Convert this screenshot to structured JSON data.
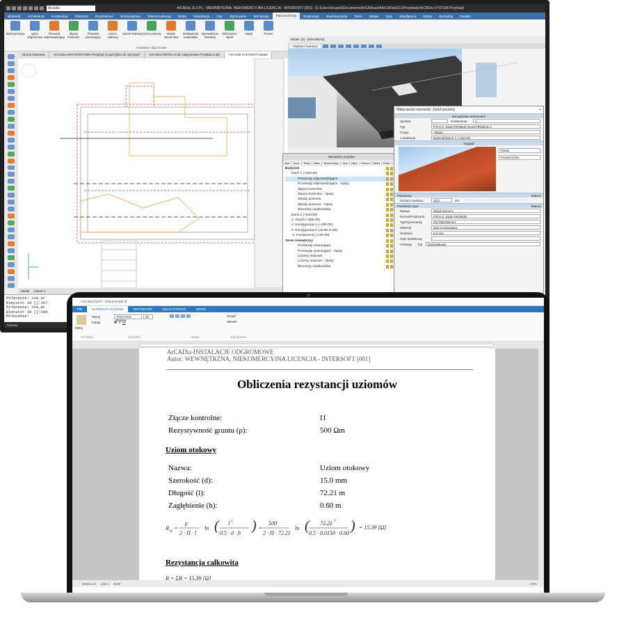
{
  "monitor": {
    "title": "ArCADia 15.0 PL - WEWNĘTRZNA, NIEKOMERCYJNA LICENCJA - INTERSOFT [001] - [C:\\Users\\knusek\\Documents\\ArCADiasoft\\ArCADia\\15.0\\Przyklady\\ArCADia SYSTEM Przyklad]",
    "layer_combo": "Arcadia",
    "menu": [
      "Biblioteki",
      "Architektura",
      "Konstrukcje",
      "Elektryka",
      "Rozdzielnice",
      "Niskoprądowe",
      "Telekomunikacja",
      "Woda",
      "Kanalizacja",
      "Gaz",
      "Ogrzewanie",
      "Wentylacja",
      "Piorunochrony",
      "Ewakuacja",
      "Inwentaryzacja",
      "Teren",
      "Wstaw",
      "Opis",
      "Współpraca",
      "Widok",
      "Zarządzaj",
      "Dodatki"
    ],
    "menu_active": "Piorunochrony",
    "ribbon": [
      {
        "label": "Zwód poziomy"
      },
      {
        "label": "Iglica odgromowa"
      },
      {
        "label": "Przewód odprowadzający"
      },
      {
        "label": "Złącze kontrolne"
      },
      {
        "label": "Przewód uziemiający"
      },
      {
        "label": "Uziom otokowy"
      },
      {
        "label": "Uziom kratowy"
      },
      {
        "label": "Uziom prętowy"
      },
      {
        "label": "Wykaz elementów"
      },
      {
        "label": "Zestawienie materiałów"
      },
      {
        "label": "Sprawdzenie instalacji"
      },
      {
        "label": "Obliczenia i raport"
      },
      {
        "label": "Opcje"
      },
      {
        "label": "Pomoc"
      }
    ],
    "ribbon_group": "Instalacje odgromowe",
    "doc_tabs": [
      "Strona Startowa",
      "ArCADia-ARCHITEKTURA Przyklad 11.apf (tylko do odczytu)*",
      "ArCADia-INSTALACJE Odgromowe Przyklad 1.apf",
      "ArCADia SYSTEM Przyklad"
    ],
    "model_tab": "Model",
    "layout_tab": "Arkusz 1",
    "command_lines": [
      "Polecenie: isa_ec",
      "Executor id []:107",
      "Polecenie: isa_ec",
      "Executor id []:108",
      "Polecenie:"
    ],
    "status": "Gotowy",
    "view3d_title": "Widok: [3] - [Niezależny]",
    "view3d_camera": "<Wybierz kamerę>",
    "project_manager": {
      "title": "Menadżer projektu",
      "tabs": [
        "Wid.",
        "Arch.",
        "Teren",
        "Bied.",
        "Woda Kana.",
        "Gaz",
        "Ogrz.",
        "Piorun",
        "Niska",
        "Elekt.",
        "Wentyl."
      ],
      "tree": [
        {
          "label": "Budynek",
          "indent": 0
        },
        {
          "label": "Dach 1 (+220.00)",
          "indent": 1
        },
        {
          "label": "Przewody odprowadzające",
          "indent": 2,
          "sel": true
        },
        {
          "label": "Przewody odprowadzające - Opisy",
          "indent": 2
        },
        {
          "label": "Złącza kontrolne",
          "indent": 2
        },
        {
          "label": "Złącza kontrolne - Opisy",
          "indent": 2
        },
        {
          "label": "Zwody poziome",
          "indent": 2
        },
        {
          "label": "Zwody poziome - Opisy",
          "indent": 2
        },
        {
          "label": "Elementy użytkownika",
          "indent": 2
        },
        {
          "label": "Dach 2 (+510.00)",
          "indent": 1
        },
        {
          "label": "2: Strych (+560.00)",
          "indent": 1
        },
        {
          "label": "1: Kondygnacja 1 (+280.00)",
          "indent": 1
        },
        {
          "label": "0: Kondygnacja 0 (±0.00=0.00)",
          "indent": 1
        },
        {
          "label": "-1: Fundamenty (-100.00)",
          "indent": 1
        },
        {
          "label": "Teren zewnętrzny",
          "indent": 0
        },
        {
          "label": "Przewody uziemiające",
          "indent": 2
        },
        {
          "label": "Przewody uziemiające - Opisy",
          "indent": 2
        },
        {
          "label": "Uziomy otokowe",
          "indent": 2
        },
        {
          "label": "Uziomy otokowe - Opisy",
          "indent": 2
        },
        {
          "label": "Elementy użytkownika",
          "indent": 2
        }
      ]
    },
    "properties": {
      "title": "Właściwości elementu: Zwód poziomy",
      "close": "×",
      "sec_manage": "Zarządzanie elementem",
      "symbol_label": "Symbol",
      "symbol_value": "",
      "id_label": "Id elementu",
      "id_value": "1",
      "typ_label": "Typ",
      "typ_value": "P.P.H.U. ELEKTROBUD ELEKTROBUD 1",
      "grupa_label": "Grupa",
      "grupa_value": "<Brak>",
      "lok_label": "Lokalizacja",
      "lok_value": "Budynek\\Dach 1 (+220.00)",
      "sec_look": "Wygląd",
      "look_opt1": "Piaski",
      "look_opt2": "Powierzchnie",
      "sec_params": "Parametry",
      "more1": "Więcej",
      "poziom_label": "Poziom montażu",
      "poziom_value": "10.0",
      "poziom_unit": "cm",
      "sec_typeparams": "Parametry typu",
      "more2": "Więcej",
      "rows": [
        {
          "k": "Nazwa",
          "v": "Zwód poziomy"
        },
        {
          "k": "Norma/Producent",
          "v": "P.P.H.U. ELEKTROBUD"
        },
        {
          "k": "Typ/Typoszereg",
          "v": "OCYNKOWANY"
        },
        {
          "k": "Materiał",
          "v": "Stal ocynkowana"
        },
        {
          "k": "Średnica",
          "v": "6.0 mm"
        },
        {
          "k": "Opis dodatkowy",
          "v": ""
        }
      ],
      "uchwyty_label": "Uchwyty",
      "uchwyty_typ_label": "Typ",
      "uchwyty_typ_value": "Dachówkowe"
    }
  },
  "laptop": {
    "title": "ArCADia-TEXT - Dokument35.rtf",
    "tabs": [
      "Plik",
      "NARZĘDZIA GŁÓWNE",
      "WSTAWIANIE",
      "UKŁAD STRONY",
      "WIDOK"
    ],
    "active_tab": "NARZĘDZIA GŁÓWNE",
    "font": "Times New Roman",
    "size": "20",
    "clip": [
      "Wytnij",
      "Kopiuj"
    ],
    "paste": "Wklej",
    "find": [
      "Znajdź",
      "Zamień"
    ],
    "groups": [
      "Schowek",
      "Czcionka",
      "Akapit",
      "Edytowanie"
    ],
    "doc": {
      "hdr1": "ArCADia-INSTALACJE ODGROMOWE",
      "hdr2": "Autor: WEWNĘTRZNA, NIEKOMERCYJNA LICENCJA - INTERSOFT [001]",
      "title": "Obliczenia rezystancji uziomów",
      "zlacze_k": "Złącze kontrolne:",
      "zlacze_v": "I1",
      "rez_k": "Rezystywność gruntu (ρ):",
      "rez_v": "500 Ωm",
      "sec1": "Uziom otokowy",
      "rows": [
        {
          "k": "Nazwa:",
          "v": "Uziom otokowy"
        },
        {
          "k": "Szerokość (d):",
          "v": "15.0 mm"
        },
        {
          "k": "Długość (l):",
          "v": "72.21 m"
        },
        {
          "k": "Zagłębienie (h):",
          "v": "0.60 m"
        }
      ],
      "sec2": "Rezystancja całkowita",
      "eq_result": "= 15.39 [Ω]",
      "eq_total": "R = ΣR  = 15.39 [Ω]"
    },
    "status_items": [
      "Strona 1/1",
      "Linia 1",
      "NUM"
    ],
    "zoom": "170%"
  }
}
